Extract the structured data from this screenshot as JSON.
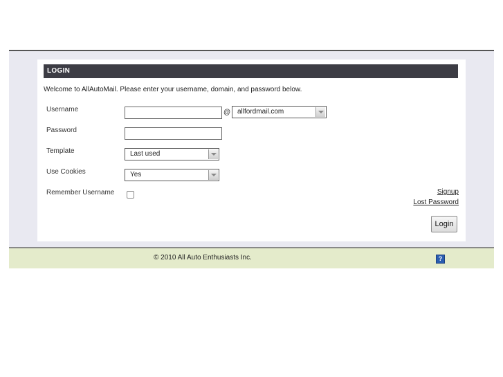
{
  "login": {
    "title": "LOGIN",
    "welcome": "Welcome to AllAutoMail. Please enter your username, domain, and password below.",
    "username_label": "Username",
    "username_value": "",
    "at_symbol": "@",
    "domain_value": "allfordmail.com",
    "password_label": "Password",
    "password_value": "",
    "template_label": "Template",
    "template_value": "Last used",
    "cookies_label": "Use Cookies",
    "cookies_value": "Yes",
    "remember_label": "Remember Username",
    "remember_checked": false,
    "signup_link": "Signup",
    "lost_password_link": "Lost Password",
    "login_button": "Login"
  },
  "footer": {
    "copyright": "© 2010 All Auto Enthusiasts Inc.",
    "help_icon": "help-icon",
    "help_glyph": "?"
  },
  "colors": {
    "title_bar": "#3c3c44",
    "panel_background": "#e9e9f1",
    "footer_background": "#e4ebcb",
    "help_icon": "#2a5db0"
  }
}
